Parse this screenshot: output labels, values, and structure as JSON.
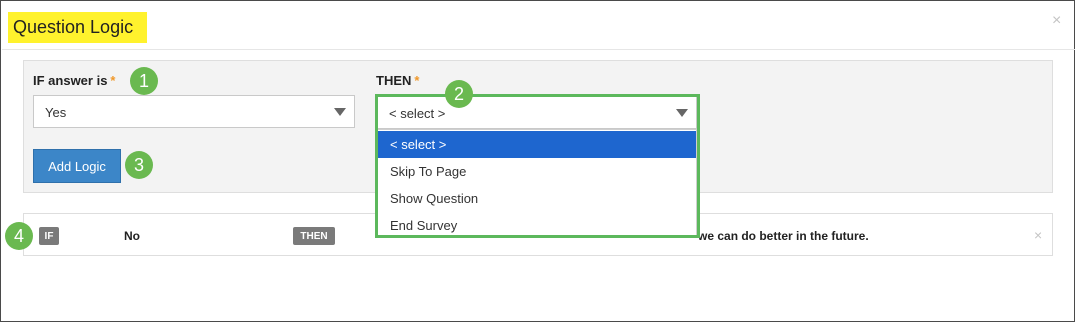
{
  "dialog": {
    "title": "Question Logic",
    "close_label": "×"
  },
  "form": {
    "if_label": "IF answer is",
    "then_label": "THEN",
    "required_mark": "*",
    "if_select_value": "Yes",
    "then_select_value": "< select >",
    "add_logic_label": "Add Logic"
  },
  "dropdown": {
    "options": [
      "< select >",
      "Skip To Page",
      "Show Question",
      "End Survey"
    ],
    "selected_index": 0
  },
  "logic_row": {
    "if_tag": "IF",
    "if_value": "No",
    "then_tag": "THEN",
    "then_value_fragment": "we can do better in the future.",
    "remove_label": "×"
  },
  "callouts": [
    "1",
    "2",
    "3",
    "4"
  ],
  "colors": {
    "title_highlight": "#fff22d",
    "callout": "#6ab950",
    "button": "#3c86c8",
    "selected_option": "#1e66cf",
    "required": "#f0982a"
  }
}
